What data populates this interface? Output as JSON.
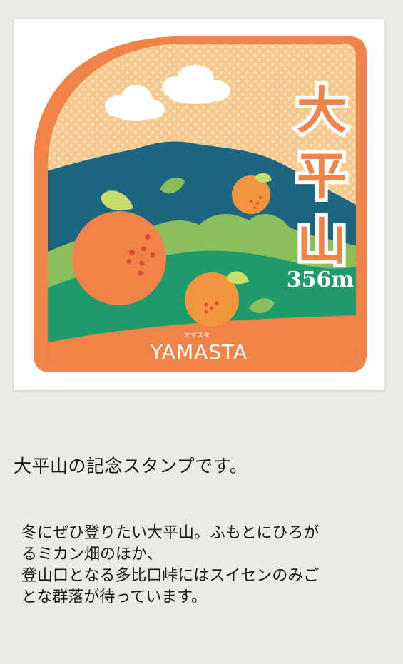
{
  "stamp": {
    "mountain_name": [
      "大",
      "平",
      "山"
    ],
    "elevation": "356m",
    "brand_kana": "ヤマスタ",
    "brand": "YAMASTA",
    "colors": {
      "frame": "#ef8348",
      "sky": "#f6c98f",
      "mountain": "#1c6681",
      "hill_light": "#8bbf5c",
      "hill_green": "#1f9a6a",
      "orange": "#ef8348",
      "leaf": "#c9dd6a"
    }
  },
  "caption": "大平山の記念スタンプです。",
  "description": [
    "冬にぜひ登りたい大平山。ふもとにひろが",
    "るミカン畑のほか、",
    "登山口となる多比口峠にはスイセンのみご",
    "とな群落が待っています。"
  ]
}
